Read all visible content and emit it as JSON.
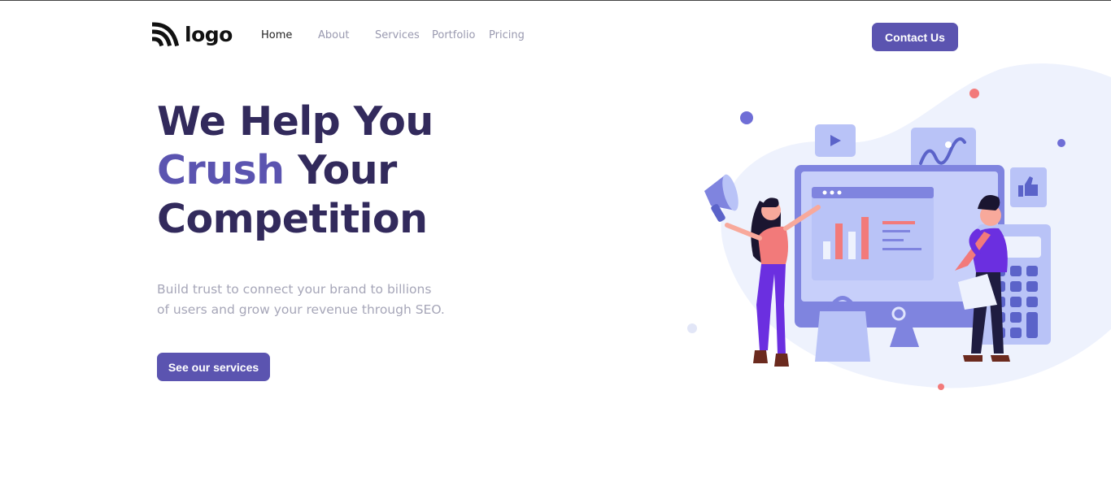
{
  "header": {
    "logo_text": "logo",
    "nav": [
      {
        "label": "Home",
        "active": true
      },
      {
        "label": "About",
        "active": false
      },
      {
        "label": "Services",
        "active": false
      },
      {
        "label": "Portfolio",
        "active": false
      },
      {
        "label": "Pricing",
        "active": false
      }
    ],
    "contact_label": "Contact Us"
  },
  "hero": {
    "title_line1": "We Help You",
    "title_accent": "Crush",
    "title_line2_rest": " Your",
    "title_line3": "Competition",
    "subtitle_line1": "Build trust to connect your brand to billions",
    "subtitle_line2": "of users and grow your revenue through SEO.",
    "cta_label": "See our services"
  },
  "colors": {
    "brand": "#5b54b0",
    "heading": "#322a5c",
    "muted": "#a6a6b8"
  },
  "illustration": {
    "icons": [
      "megaphone-icon",
      "play-icon",
      "chart-wave-icon",
      "thumbs-up-icon",
      "shopping-bag-icon",
      "calculator-icon"
    ]
  }
}
